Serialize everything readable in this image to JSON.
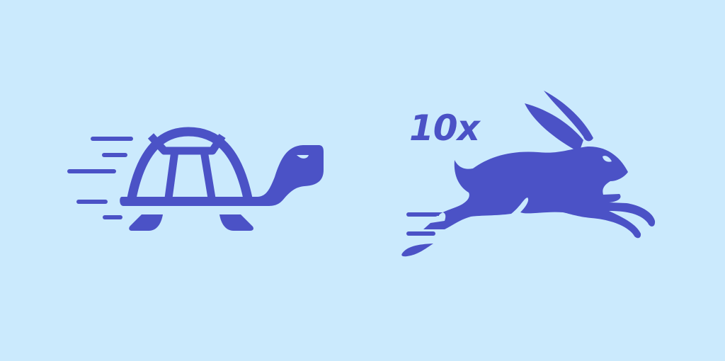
{
  "illustration": {
    "speed_label": "10x",
    "subjects": [
      "turtle-icon",
      "rabbit-icon"
    ],
    "colors": {
      "background": "#cbeafd",
      "accent": "#4b52c6"
    }
  }
}
